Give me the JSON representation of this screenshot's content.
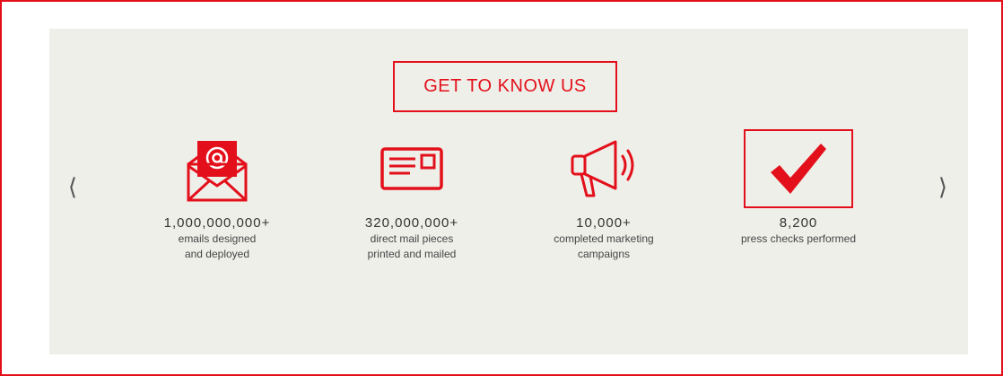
{
  "heading": "GET TO KNOW US",
  "carousel": {
    "prev_glyph": "⟨",
    "next_glyph": "⟩"
  },
  "stats": [
    {
      "icon": "email-envelope-icon",
      "number": "1,000,000,000+",
      "description": "emails designed\nand deployed"
    },
    {
      "icon": "direct-mail-card-icon",
      "number": "320,000,000+",
      "description": "direct mail pieces\nprinted and mailed"
    },
    {
      "icon": "megaphone-icon",
      "number": "10,000+",
      "description": "completed marketing\ncampaigns"
    },
    {
      "icon": "checkmark-icon",
      "number": "8,200",
      "description": "press checks performed"
    }
  ],
  "colors": {
    "accent": "#e3101b",
    "panel_background": "#efefea",
    "text": "#333333"
  }
}
